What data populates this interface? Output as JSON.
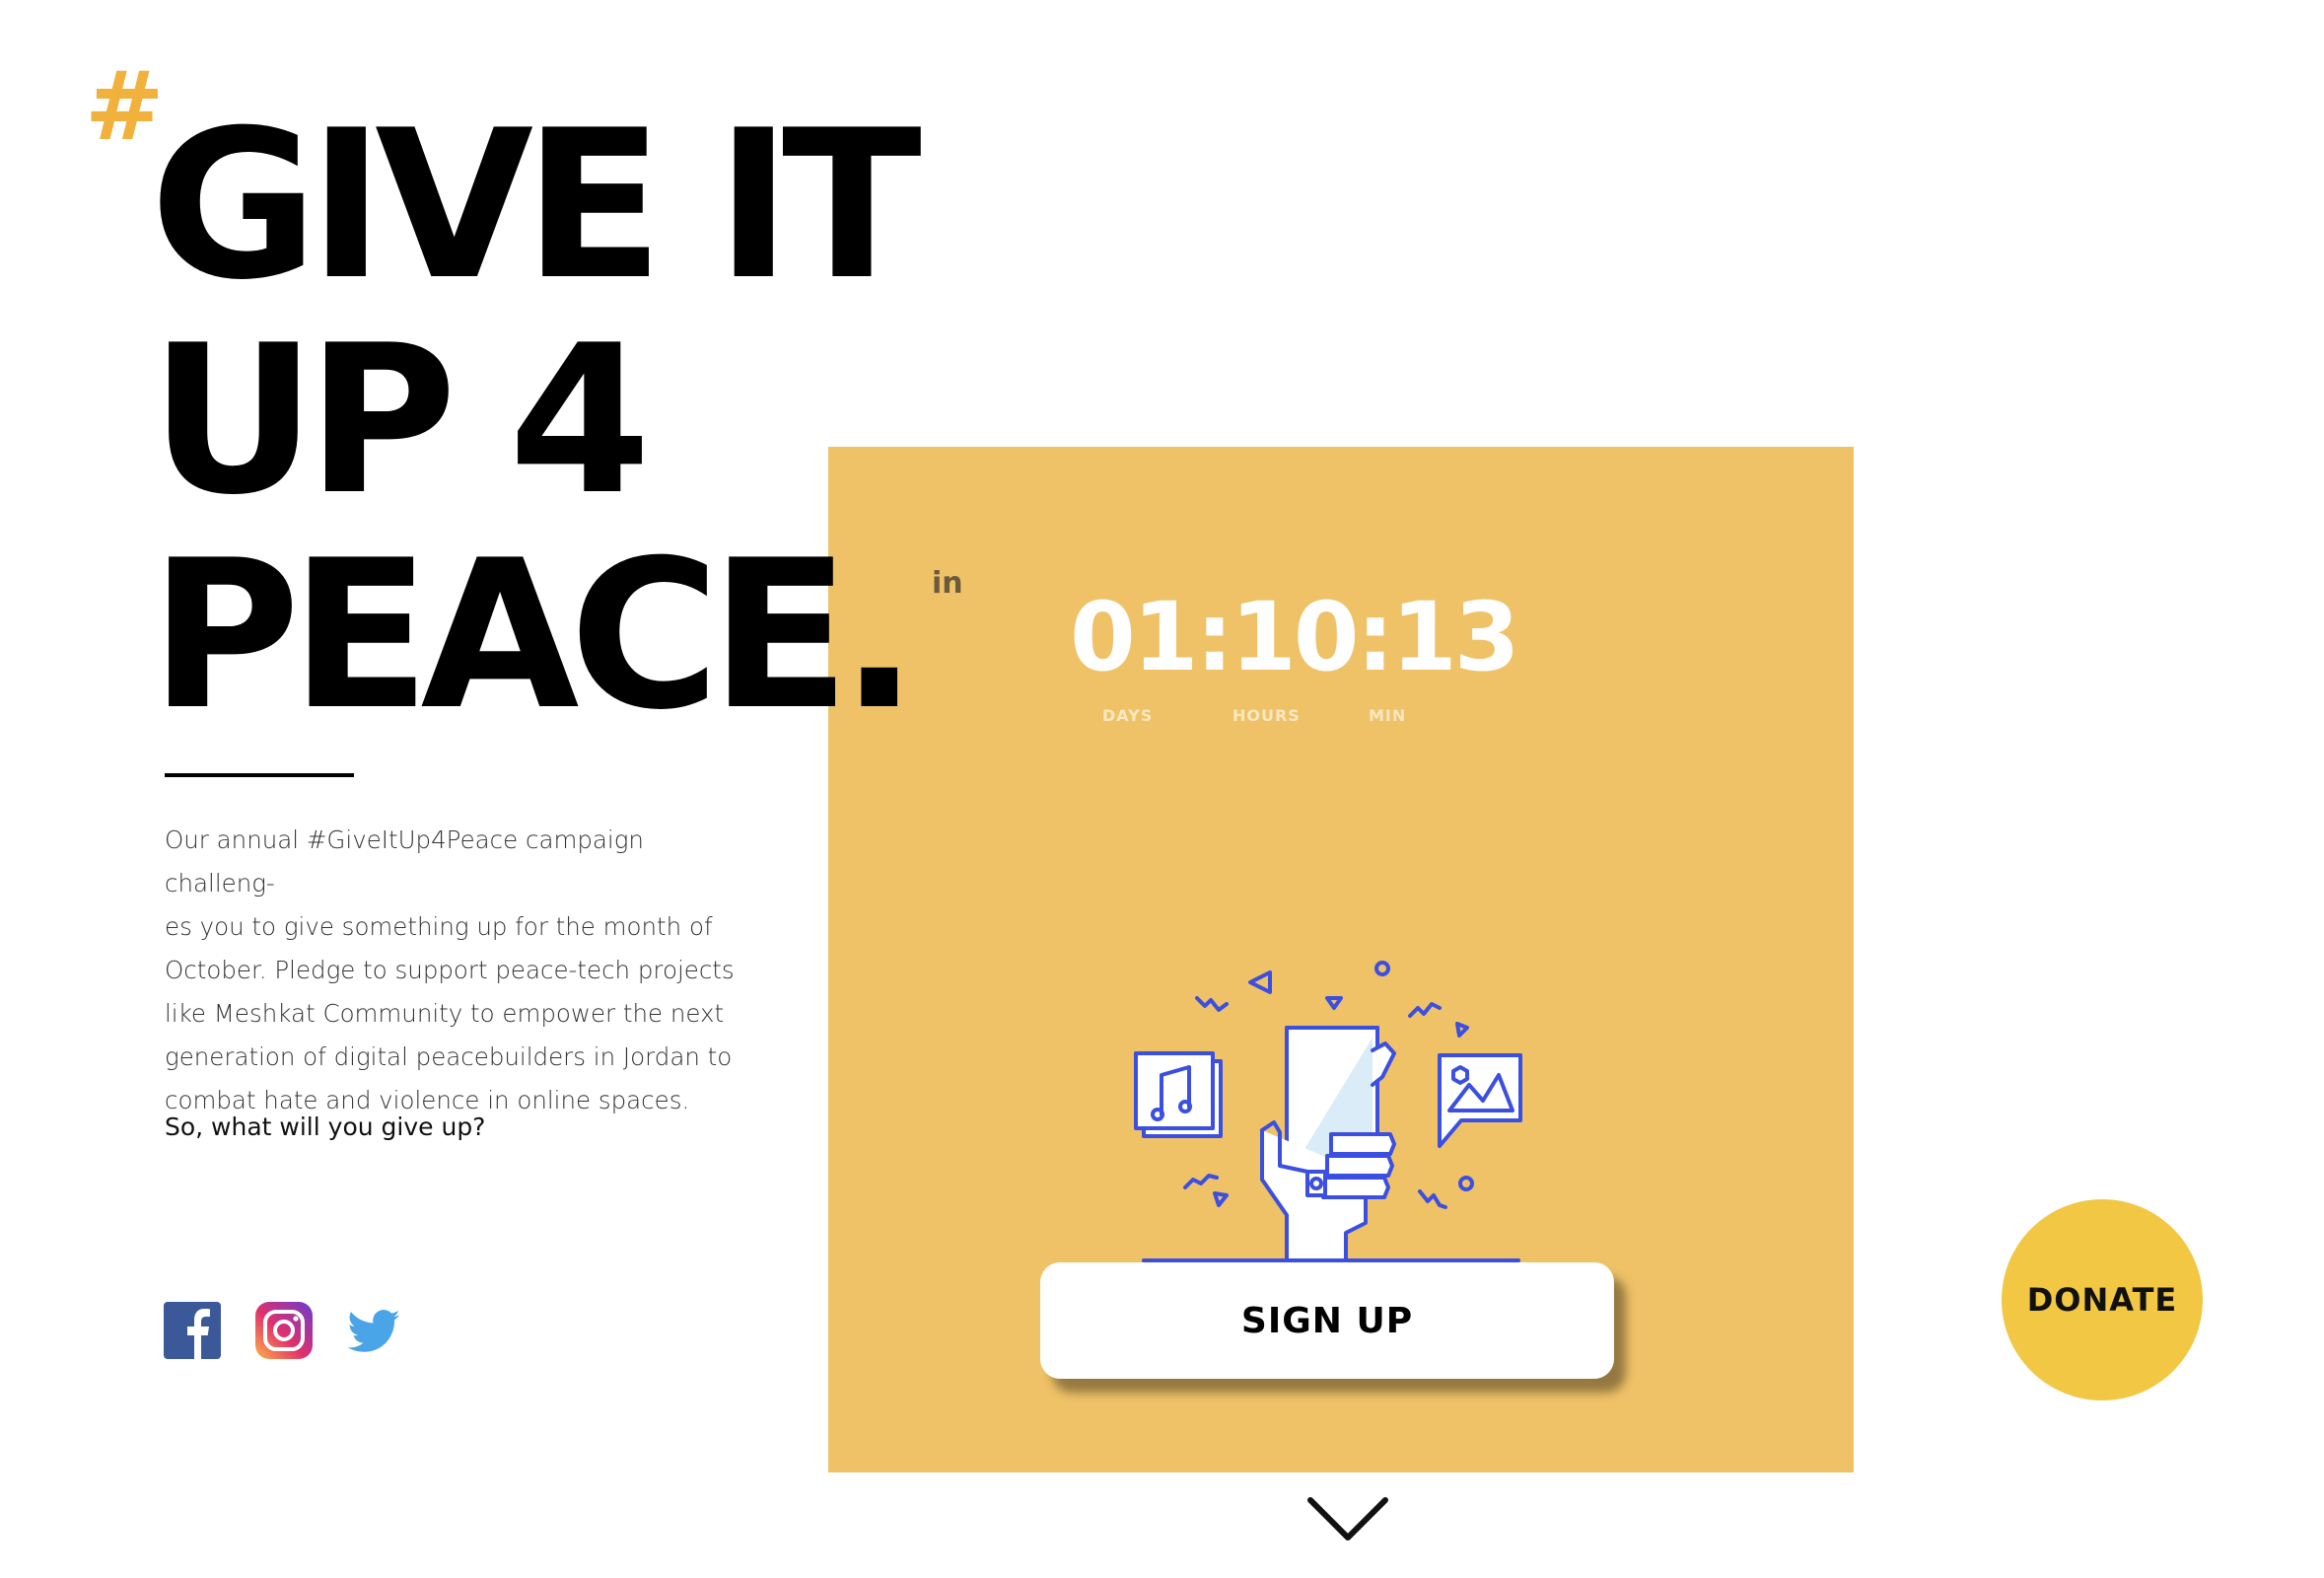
{
  "hero": {
    "hash_symbol": "#",
    "headline_lines": [
      "GIVE IT",
      "UP 4",
      "PEACE."
    ],
    "in_label": "in"
  },
  "countdown": {
    "value": "01:10:13",
    "units": [
      "DAYS",
      "HOURS",
      "MIN"
    ]
  },
  "intro": {
    "paragraph_lines": [
      "Our annual #GiveItUp4Peace campaign challeng-",
      "es you to give something up for the month of",
      "October. Pledge to support peace-tech projects",
      "like Meshkat Community to empower the next",
      "generation of digital peacebuilders in Jordan to",
      "combat hate and violence in online spaces."
    ],
    "question": "So, what will you give up?"
  },
  "social": {
    "icons": [
      "facebook-icon",
      "instagram-icon",
      "twitter-icon"
    ]
  },
  "actions": {
    "signup_label": "SIGN UP",
    "donate_label": "DONATE"
  },
  "colors": {
    "panel": "#efc267",
    "hash": "#f1b13d",
    "donate": "#f2c744",
    "illustration_stroke": "#3b4fe0"
  }
}
